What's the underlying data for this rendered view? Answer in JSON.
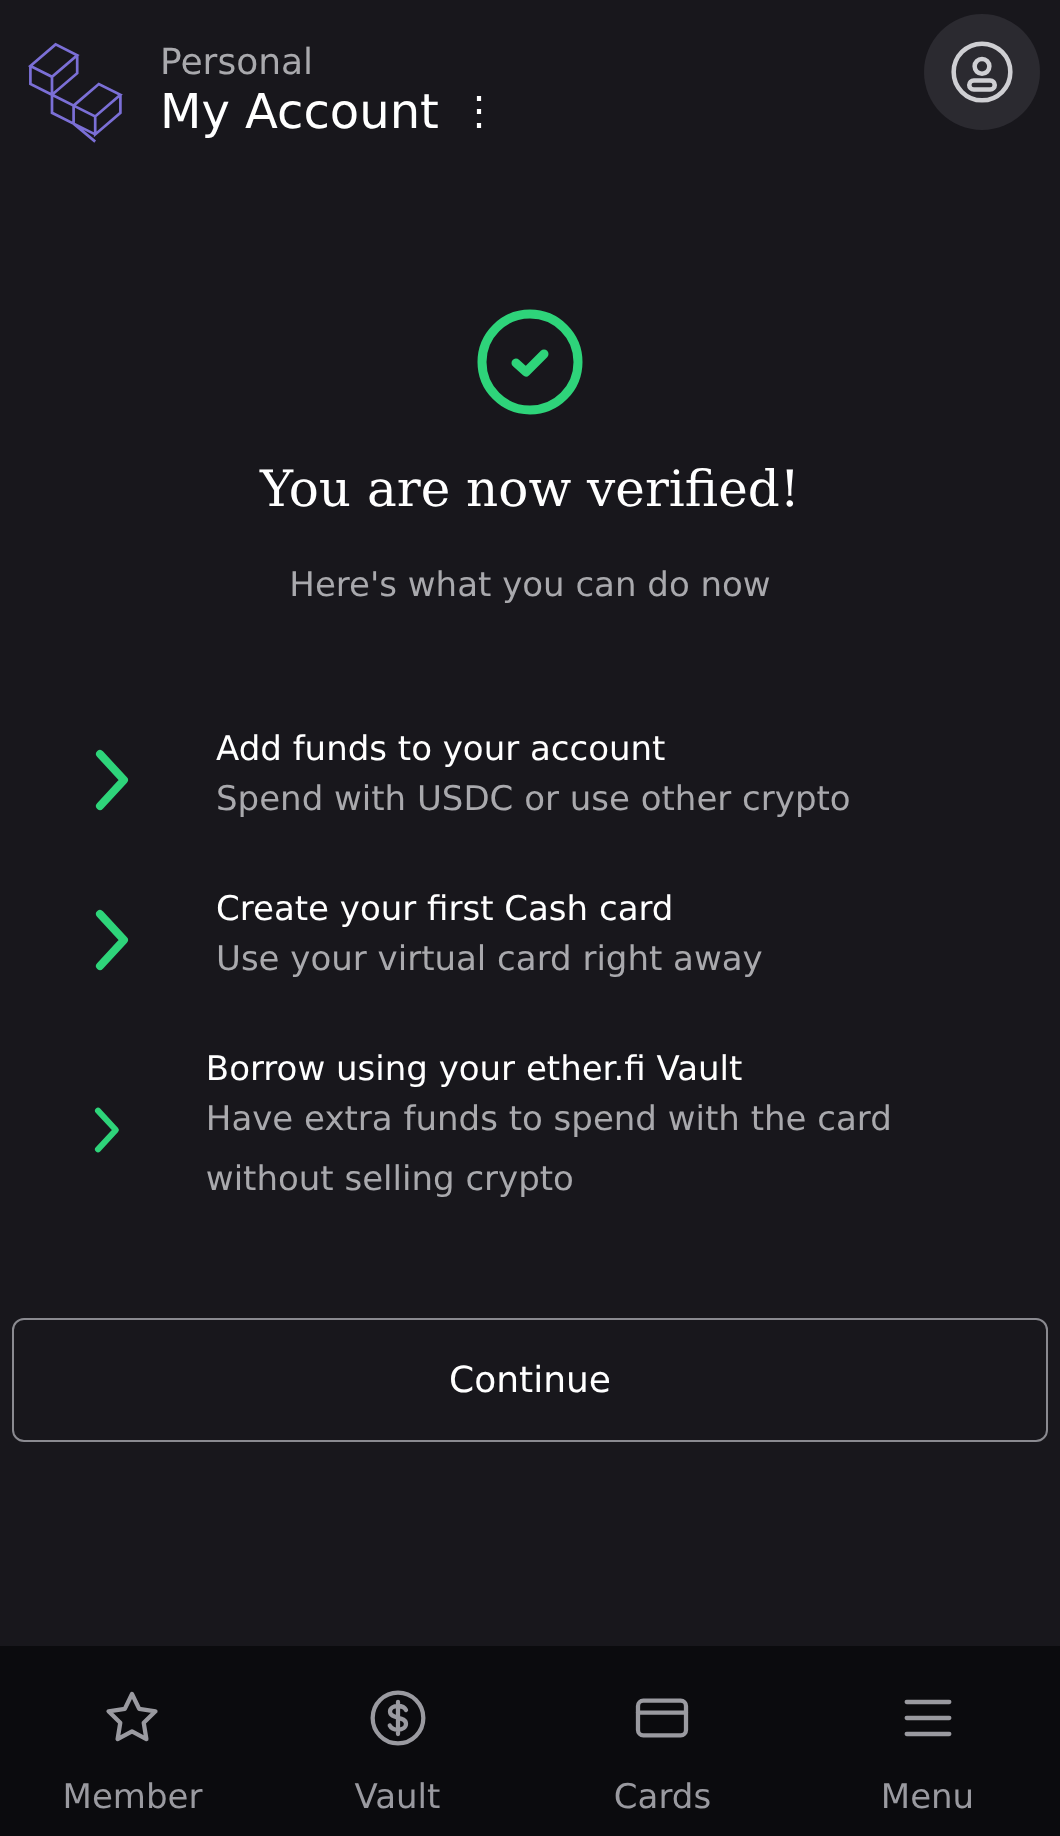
{
  "header": {
    "subtitle": "Personal",
    "title": "My Account",
    "menu_glyph": "⋮"
  },
  "headline": "You are now verified!",
  "intro": "Here's what you can do now",
  "steps": [
    {
      "title": "Add funds to your account",
      "description": "Spend with USDC or use other crypto"
    },
    {
      "title": "Create your first Cash card",
      "description": "Use your virtual card right away"
    },
    {
      "title": "Borrow using your ether.fi Vault",
      "description": "Have extra funds to spend with the card without selling crypto"
    }
  ],
  "continue_button": "Continue",
  "nav": [
    {
      "kind": "star",
      "label": "Member"
    },
    {
      "kind": "dollar",
      "label": "Vault"
    },
    {
      "kind": "card",
      "label": "Cards"
    },
    {
      "kind": "menu",
      "label": "Menu"
    }
  ]
}
